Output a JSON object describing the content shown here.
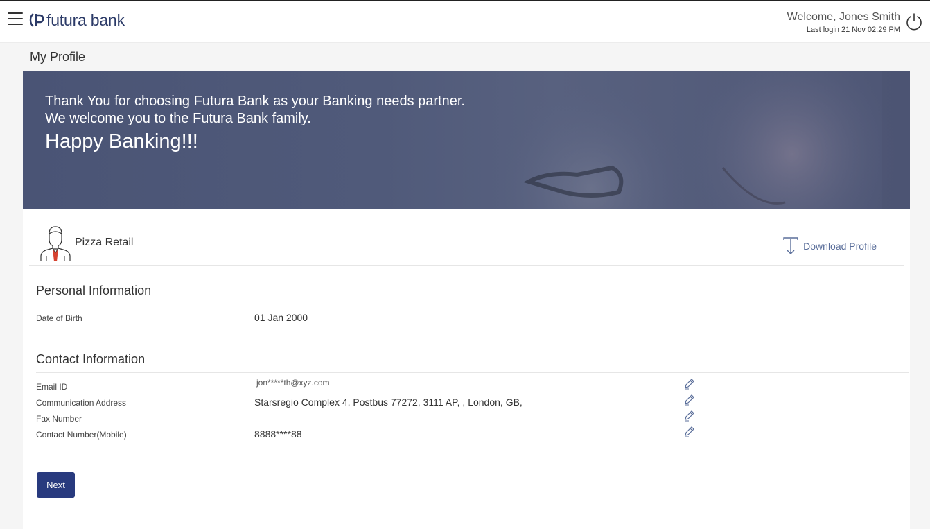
{
  "header": {
    "brand": "futura bank",
    "welcome_text": "Welcome, Jones Smith",
    "last_login": "Last login 21 Nov 02:29 PM",
    "brand_color": "#2b3a67"
  },
  "page": {
    "title": "My Profile"
  },
  "banner": {
    "line1": "Thank You for choosing Futura Bank as your Banking needs partner.",
    "line2": "We welcome you to the Futura Bank family.",
    "line3": "Happy Banking!!!"
  },
  "profile": {
    "name": "Pizza Retail",
    "download_label": "Download Profile"
  },
  "personal": {
    "title": "Personal Information",
    "dob_label": "Date of Birth",
    "dob_value": "01 Jan 2000"
  },
  "contact": {
    "title": "Contact Information",
    "email_label": "Email ID",
    "email_value": "jon*****th@xyz.com",
    "address_label": "Communication Address",
    "address_value": "Starsregio Complex 4, Postbus 77272, 3111 AP, , London, GB,",
    "fax_label": "Fax Number",
    "fax_value": "",
    "mobile_label": "Contact Number(Mobile)",
    "mobile_value": "8888****88"
  },
  "actions": {
    "next_label": "Next",
    "button_color": "#283a7e"
  },
  "icons": {
    "menu": "hamburger-menu-icon",
    "logo": "futura-logo-icon",
    "logout": "power-icon",
    "avatar": "user-avatar-icon",
    "download": "download-icon",
    "edit": "pencil-edit-icon"
  }
}
